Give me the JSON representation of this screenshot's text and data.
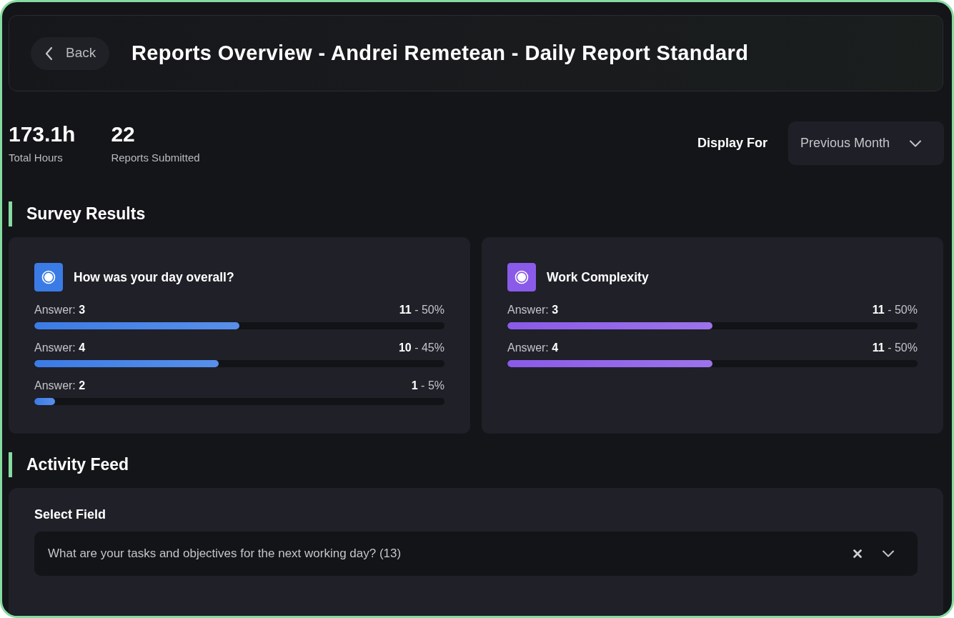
{
  "header": {
    "back_button": {
      "label": "Back"
    },
    "title": "Reports Overview - Andrei Remetean - Daily Report Standard"
  },
  "stats": [
    {
      "value": "173.1h",
      "label": "Total Hours"
    },
    {
      "value": "22",
      "label": "Reports Submitted"
    }
  ],
  "display_for": {
    "label": "Display For",
    "value": "Previous Month"
  },
  "survey_results": {
    "heading": "Survey Results",
    "questions": [
      {
        "title": "How was your day overall?",
        "color": "#3b7be6",
        "answers": [
          {
            "label": "Answer: **3**",
            "count": "**11** - 50%",
            "level": 0.5
          },
          {
            "label": "Answer: **4**",
            "count": "**10** - 45%",
            "level": 0.45
          },
          {
            "label": "Answer: **2**",
            "count": "**1** - 5%",
            "level": 0.05
          }
        ]
      },
      {
        "title": "Work Complexity",
        "color": "#8a5ae8",
        "answers": [
          {
            "label": "Answer: **3**",
            "count": "**11** - 50%",
            "level": 0.5
          },
          {
            "label": "Answer: **4**",
            "count": "**11** - 50%",
            "level": 0.5
          }
        ]
      }
    ]
  },
  "activity_feed": {
    "heading": "Activity Feed",
    "select_field": {
      "label": "Select Field",
      "value": "What are your tasks and objectives for the next working day? (13)"
    }
  }
}
